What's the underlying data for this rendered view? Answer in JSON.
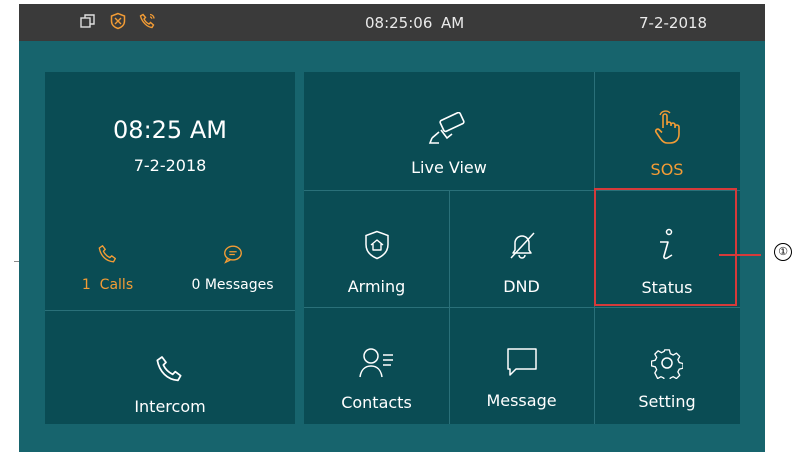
{
  "statusbar": {
    "time": "08:25:06",
    "ampm": "AM",
    "date": "7-2-2018",
    "icons": [
      "window-icon",
      "shield-icon",
      "phone-icon"
    ]
  },
  "left_panel": {
    "clock_time": "08:25 AM",
    "clock_date": "7-2-2018",
    "calls_label": "1  Calls",
    "messages_label": "0 Messages",
    "intercom_label": "Intercom"
  },
  "tiles": {
    "live_view": "Live View",
    "sos": "SOS",
    "arming": "Arming",
    "dnd": "DND",
    "status": "Status",
    "contacts": "Contacts",
    "message": "Message",
    "setting": "Setting"
  },
  "callout": {
    "number": "①"
  },
  "colors": {
    "background": "#17646d",
    "panel": "#0a4c54",
    "statusbar": "#3a3a3a",
    "accent_orange": "#f39c35",
    "highlight_red": "#d63a3a"
  }
}
